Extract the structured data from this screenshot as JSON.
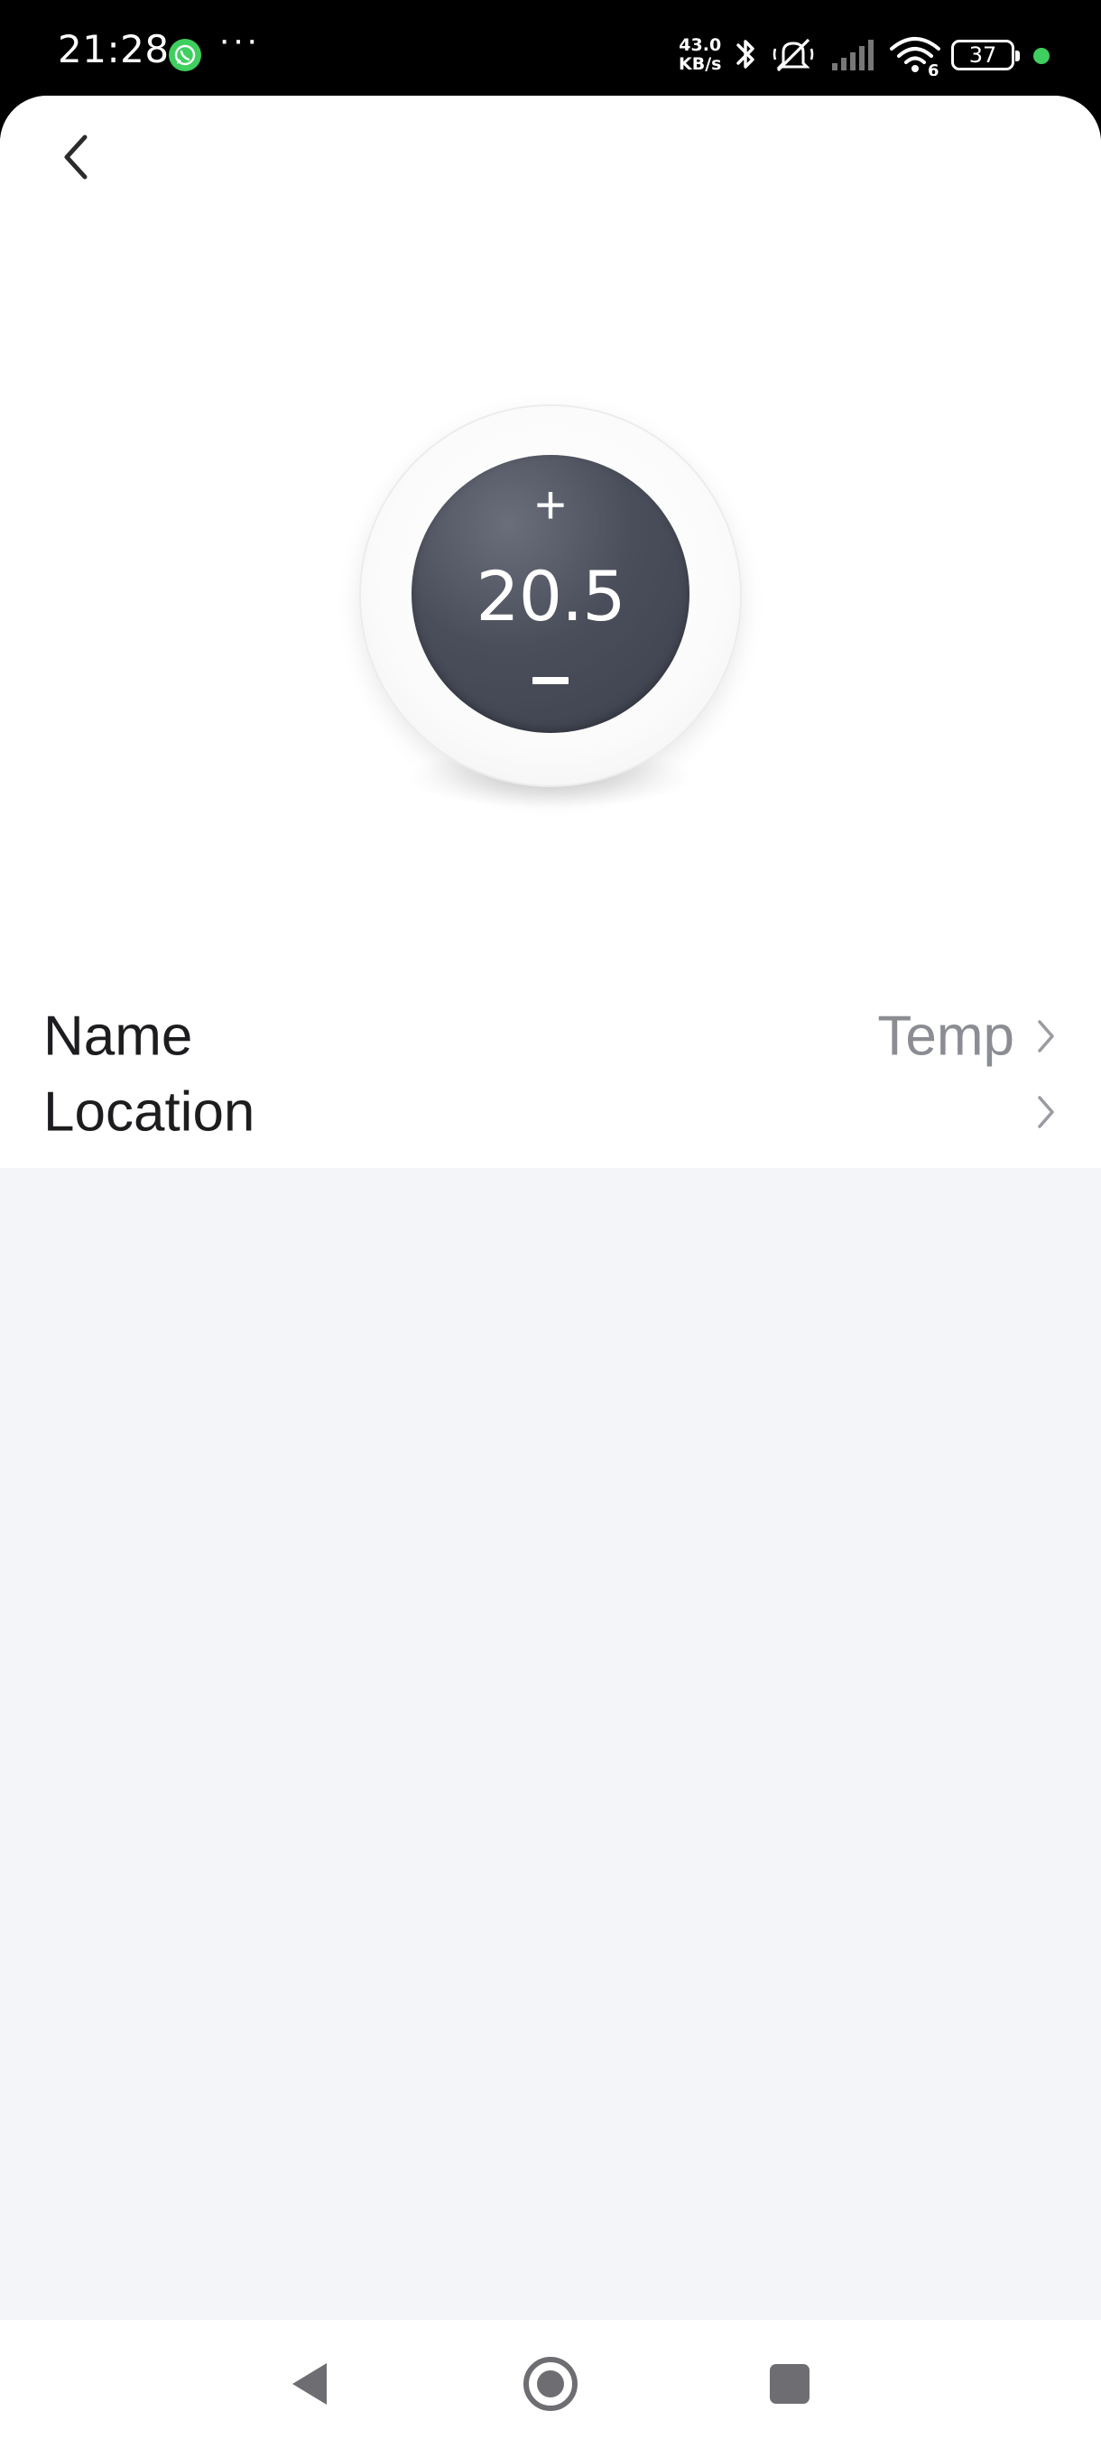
{
  "status_bar": {
    "time": "21:28",
    "more": "···",
    "speed_value": "43.0",
    "speed_unit": "KB/s",
    "battery": "37",
    "whatsapp_color": "#3ecf5e",
    "active_dot_color": "#3ecf5e",
    "icons": [
      "whatsapp-icon",
      "bluetooth-icon",
      "silent-bell-icon",
      "signal-icon",
      "wifi-icon",
      "battery-icon"
    ]
  },
  "header": {
    "back_icon": "chevron-left-icon"
  },
  "thermostat": {
    "value": "20.5",
    "increase_symbol": "+",
    "dial_color": "#454955"
  },
  "settings": [
    {
      "label": "Name",
      "value": "Temp"
    },
    {
      "label": "Location",
      "value": ""
    }
  ],
  "nav_bar": {
    "icons": [
      "back-triangle-icon",
      "home-circle-icon",
      "recents-square-icon"
    ]
  }
}
